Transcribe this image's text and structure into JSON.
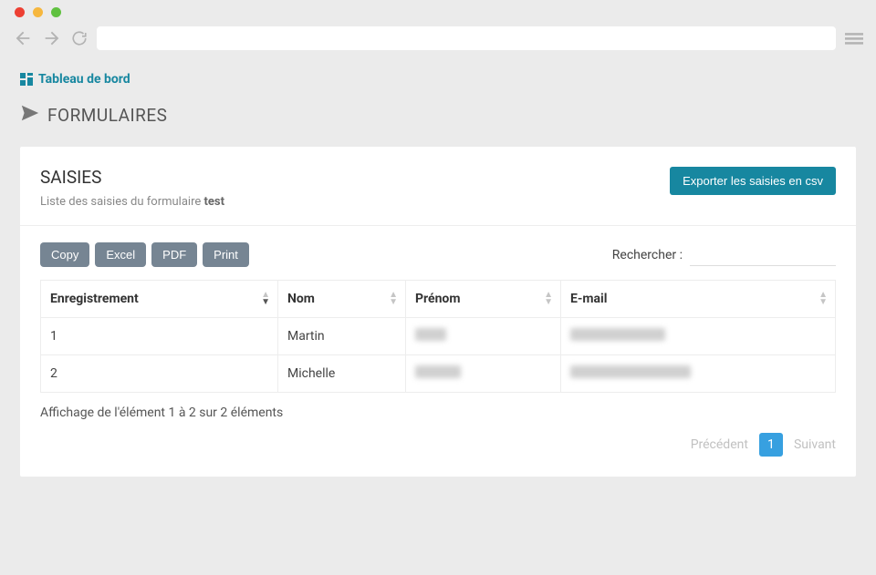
{
  "breadcrumb": {
    "label": "Tableau de bord"
  },
  "page_title": "FORMULAIRES",
  "card": {
    "title": "SAISIES",
    "subtitle_prefix": "Liste des saisies du formulaire ",
    "subtitle_formname": "test",
    "export_label": "Exporter les saisies en csv"
  },
  "toolbar": {
    "copy": "Copy",
    "excel": "Excel",
    "pdf": "PDF",
    "print": "Print"
  },
  "search": {
    "label": "Rechercher :",
    "value": ""
  },
  "table": {
    "columns": {
      "enregistrement": "Enregistrement",
      "nom": "Nom",
      "prenom": "Prénom",
      "email": "E-mail"
    },
    "col_widths": [
      "260",
      "140",
      "170",
      "auto"
    ],
    "rows": [
      {
        "enregistrement": "1",
        "nom": "Martin",
        "prenom_blur_w": 34,
        "email_blur_w": 104
      },
      {
        "enregistrement": "2",
        "nom": "Michelle",
        "prenom_blur_w": 50,
        "email_blur_w": 132
      }
    ]
  },
  "footer": {
    "info": "Affichage de l'élément 1 à 2 sur 2 éléments",
    "prev": "Précédent",
    "page": "1",
    "next": "Suivant"
  }
}
